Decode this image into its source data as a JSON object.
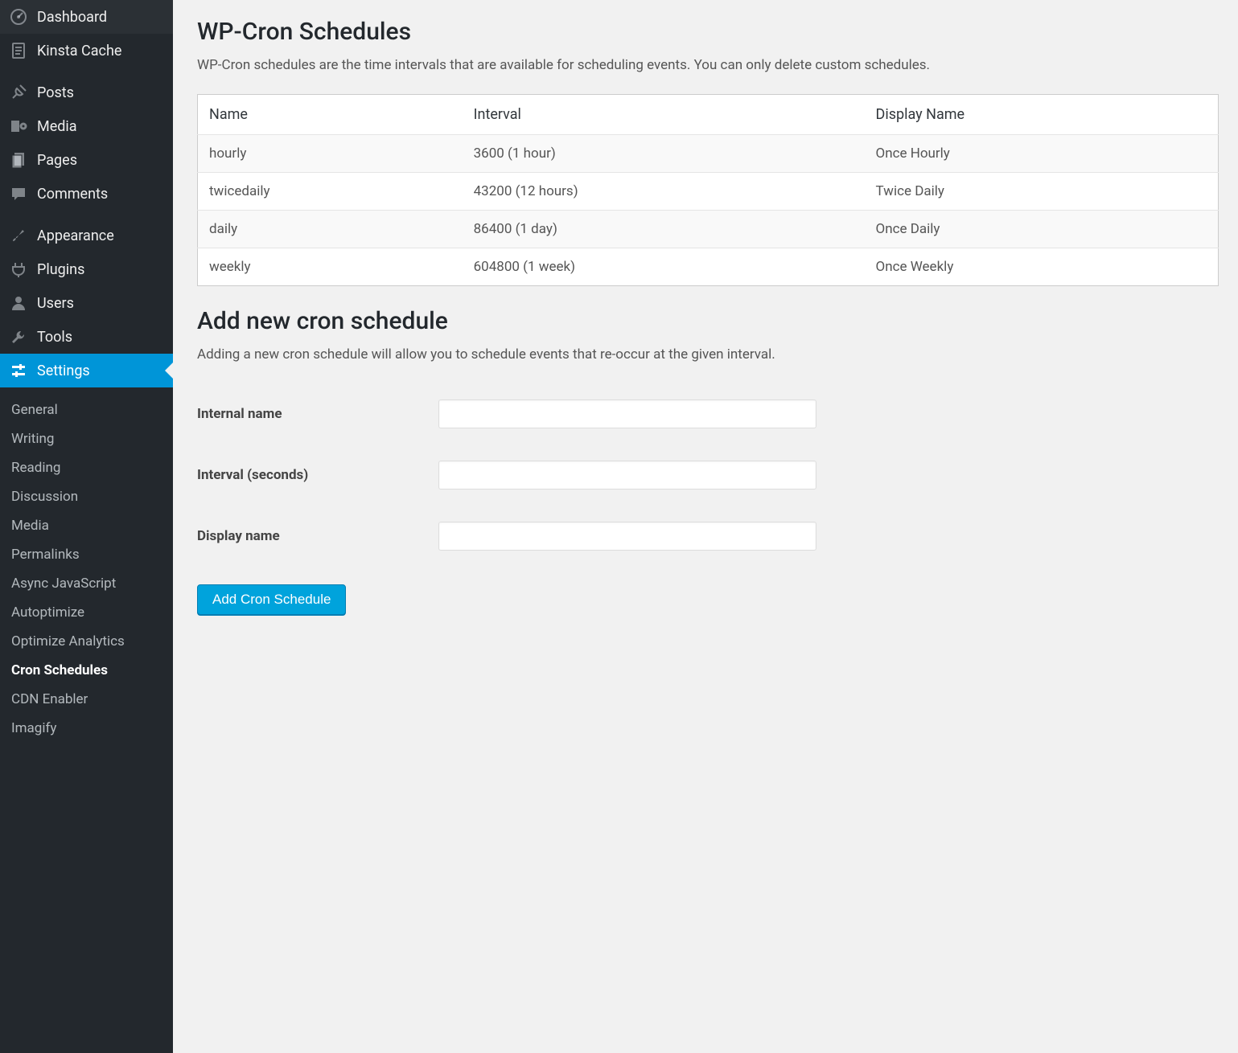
{
  "sidebar": {
    "groups": [
      [
        {
          "icon": "dashboard",
          "label": "Dashboard"
        },
        {
          "icon": "document",
          "label": "Kinsta Cache"
        }
      ],
      [
        {
          "icon": "pin",
          "label": "Posts"
        },
        {
          "icon": "media",
          "label": "Media"
        },
        {
          "icon": "pages",
          "label": "Pages"
        },
        {
          "icon": "comment",
          "label": "Comments"
        }
      ],
      [
        {
          "icon": "brush",
          "label": "Appearance"
        },
        {
          "icon": "plug",
          "label": "Plugins"
        },
        {
          "icon": "user",
          "label": "Users"
        },
        {
          "icon": "wrench",
          "label": "Tools"
        },
        {
          "icon": "settings",
          "label": "Settings",
          "active": true
        }
      ]
    ],
    "submenu": [
      {
        "label": "General"
      },
      {
        "label": "Writing"
      },
      {
        "label": "Reading"
      },
      {
        "label": "Discussion"
      },
      {
        "label": "Media"
      },
      {
        "label": "Permalinks"
      },
      {
        "label": "Async JavaScript"
      },
      {
        "label": "Autoptimize"
      },
      {
        "label": "Optimize Analytics"
      },
      {
        "label": "Cron Schedules",
        "current": true
      },
      {
        "label": "CDN Enabler"
      },
      {
        "label": "Imagify"
      }
    ]
  },
  "page": {
    "heading1": "WP-Cron Schedules",
    "desc1": "WP-Cron schedules are the time intervals that are available for scheduling events. You can only delete custom schedules.",
    "table": {
      "headers": [
        "Name",
        "Interval",
        "Display Name"
      ],
      "rows": [
        [
          "hourly",
          "3600 (1 hour)",
          "Once Hourly"
        ],
        [
          "twicedaily",
          "43200 (12 hours)",
          "Twice Daily"
        ],
        [
          "daily",
          "86400 (1 day)",
          "Once Daily"
        ],
        [
          "weekly",
          "604800 (1 week)",
          "Once Weekly"
        ]
      ]
    },
    "heading2": "Add new cron schedule",
    "desc2": "Adding a new cron schedule will allow you to schedule events that re-occur at the given interval.",
    "form": {
      "fields": [
        {
          "label": "Internal name",
          "name": "internal-name"
        },
        {
          "label": "Interval (seconds)",
          "name": "interval-seconds"
        },
        {
          "label": "Display name",
          "name": "display-name"
        }
      ],
      "submit_label": "Add Cron Schedule"
    }
  }
}
